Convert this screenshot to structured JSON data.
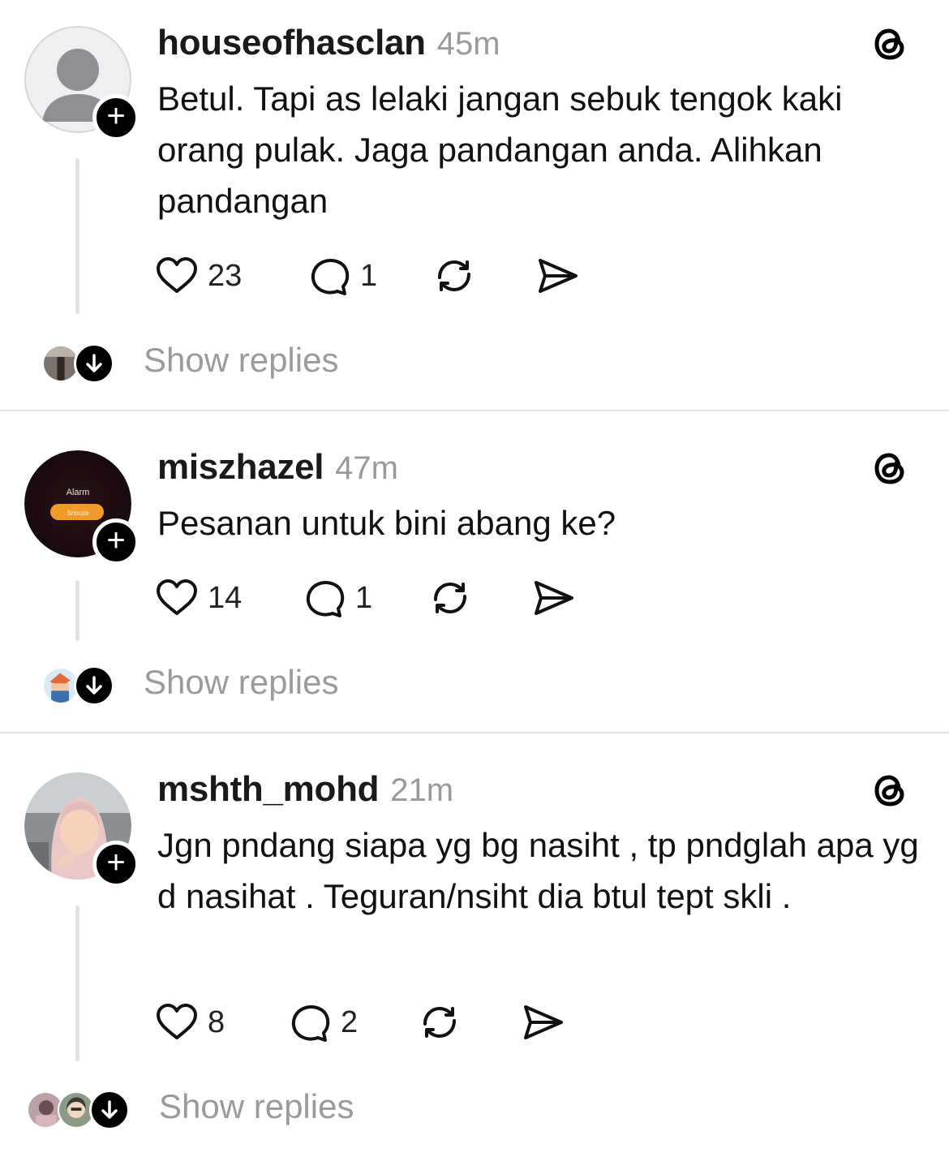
{
  "posts": [
    {
      "username": "houseofhasclan",
      "time": "45m",
      "text": "Betul. Tapi as lelaki jangan sebuk tengok kaki orang pulak. Jaga pandangan anda. Alihkan pandangan",
      "likes": "23",
      "replies": "1",
      "avatar_icon": "default-user-avatar",
      "show_replies_label": "Show replies"
    },
    {
      "username": "miszhazel",
      "time": "47m",
      "text": "Pesanan untuk bini abang ke?",
      "likes": "14",
      "replies": "1",
      "avatar_text": "Alarm",
      "avatar_button": "Snooze",
      "show_replies_label": "Show replies"
    },
    {
      "username": "mshth_mohd",
      "time": "21m",
      "text": "Jgn pndang siapa yg bg nasiht , tp pndglah apa yg d nasihat . Teguran/nsiht dia btul tept skli .",
      "likes": "8",
      "replies": "2",
      "avatar_icon": "profile-photo",
      "show_replies_label": "Show replies"
    }
  ],
  "icons": {
    "like": "heart-icon",
    "reply": "comment-icon",
    "repost": "repost-icon",
    "share": "send-icon",
    "app": "threads-logo-icon",
    "expand": "arrow-down-icon",
    "follow": "plus-icon"
  },
  "colors": {
    "text": "#111111",
    "muted": "#9b9b9b",
    "divider": "#e2e2e2",
    "badge": "#000000"
  }
}
